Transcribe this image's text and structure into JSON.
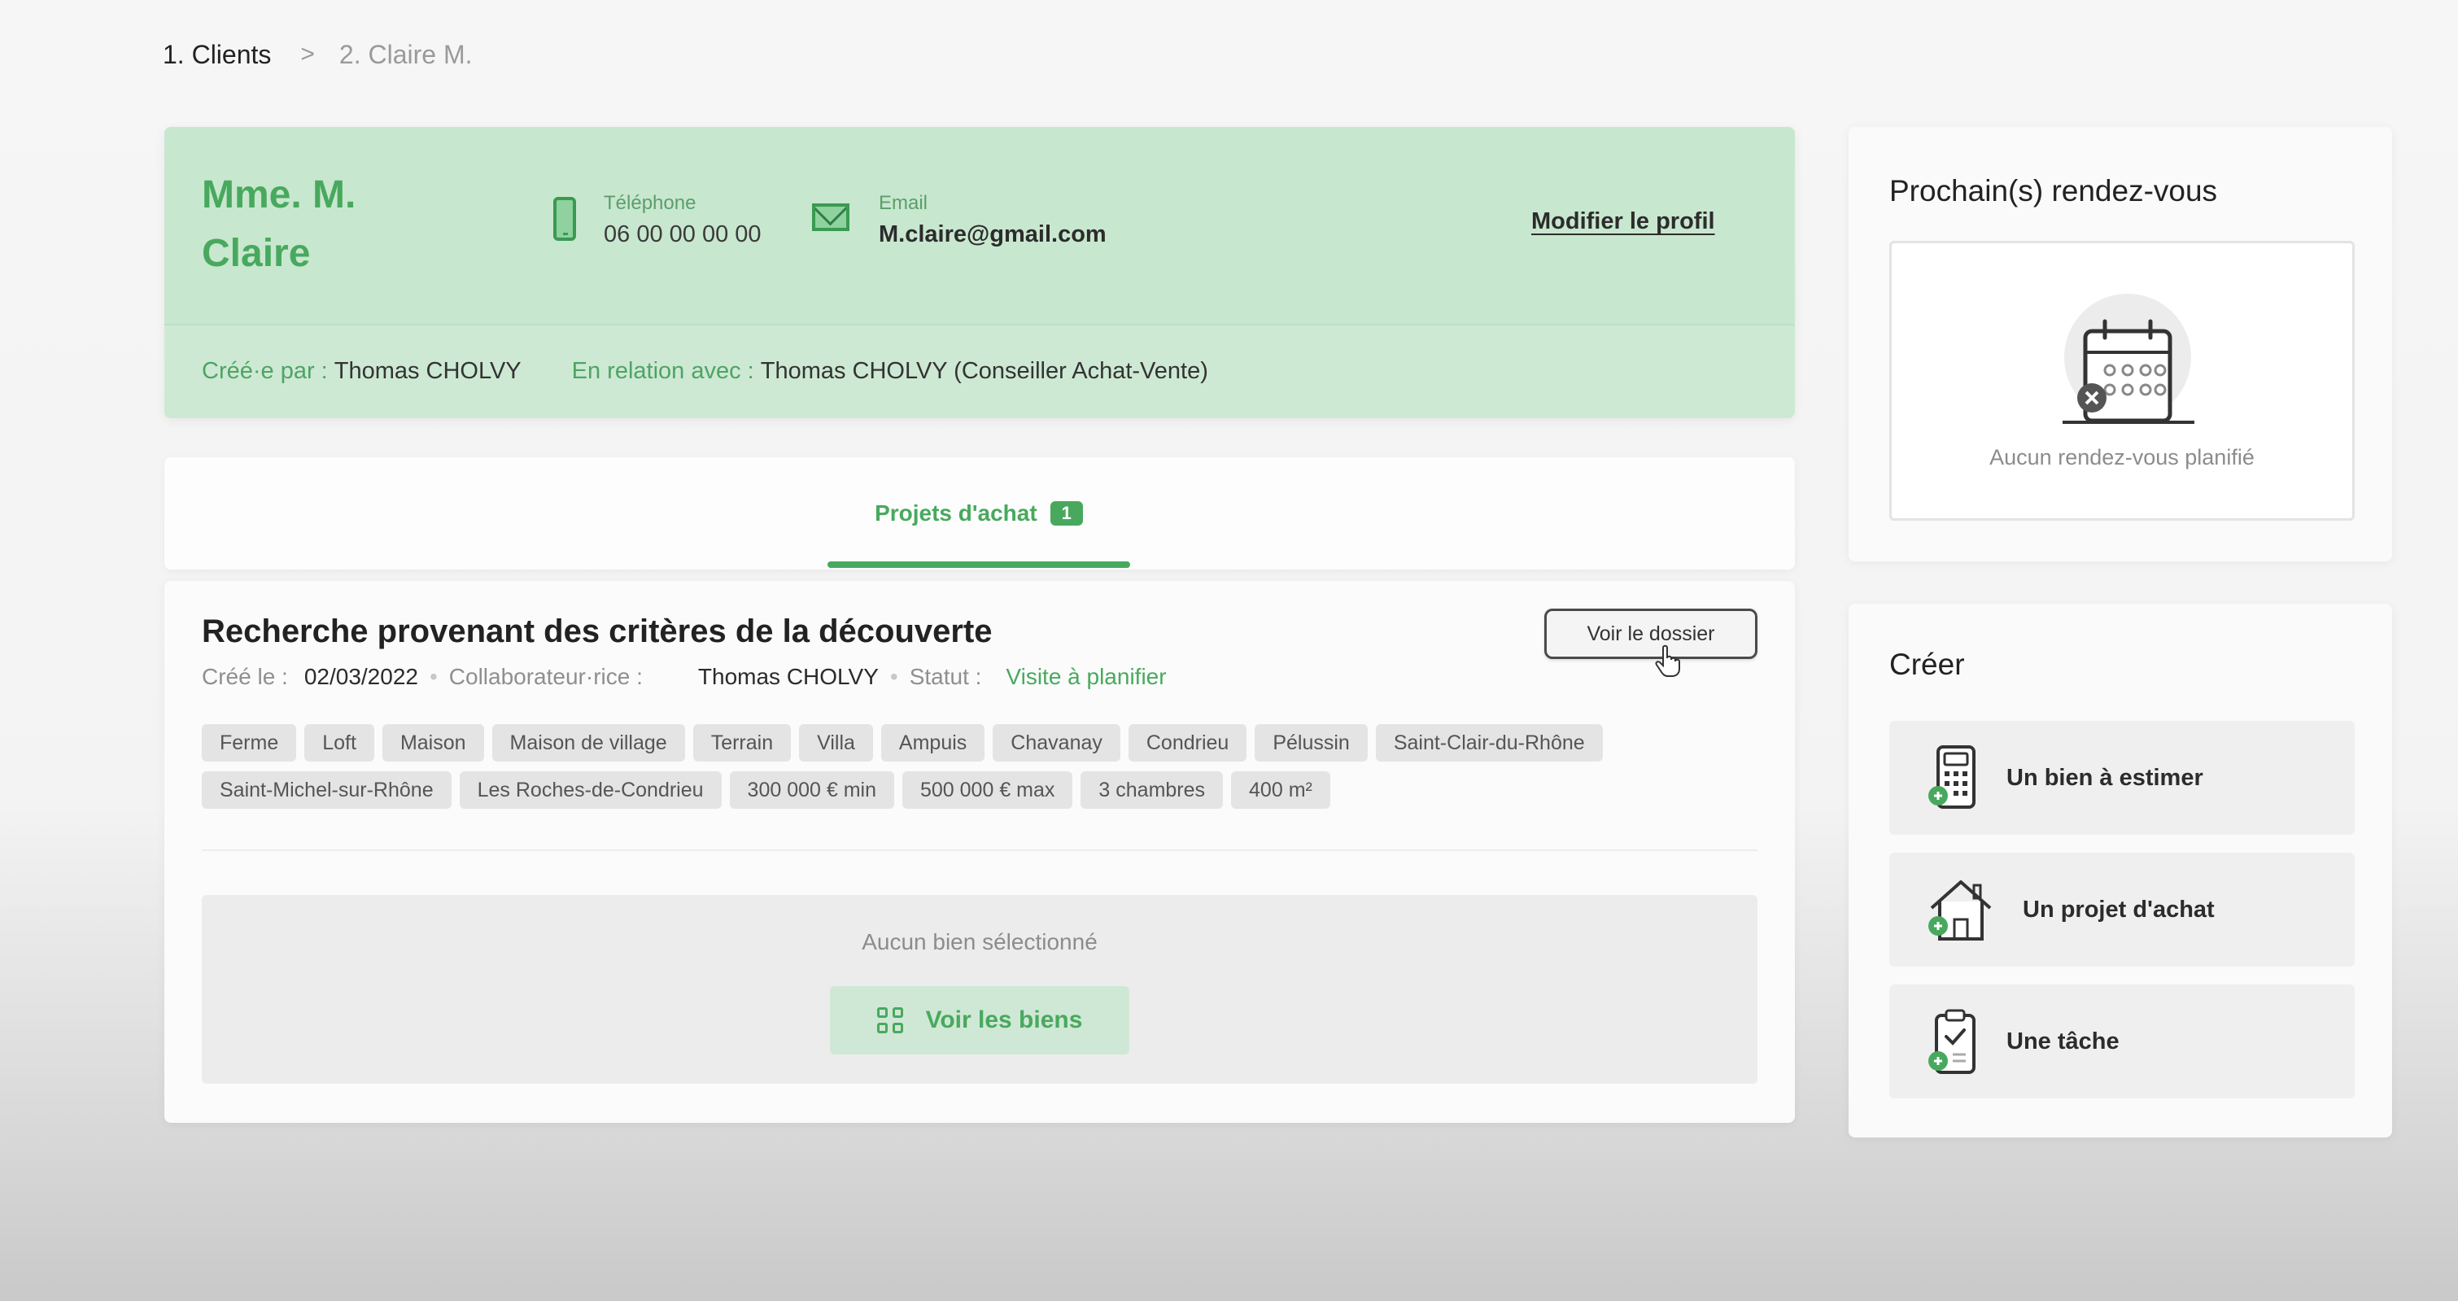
{
  "breadcrumb": {
    "step1": "1. Clients",
    "separator": ">",
    "step2": "2. Claire M."
  },
  "client": {
    "name": "Mme. M. Claire",
    "phone_label": "Téléphone",
    "phone_value": "06 00 00 00 00",
    "email_label": "Email",
    "email_value": "M.claire@gmail.com",
    "edit_profile": "Modifier le profil",
    "created_by_label": "Créé·e par :",
    "created_by_value": "Thomas CHOLVY",
    "relation_label": "En relation avec :",
    "relation_value": "Thomas CHOLVY (Conseiller Achat-Vente)"
  },
  "tabs": {
    "purchase_label": "Projets d'achat",
    "purchase_count": "1"
  },
  "project": {
    "title": "Recherche provenant des critères de la découverte",
    "created_label": "Créé le :",
    "created_value": "02/03/2022",
    "collaborator_label": "Collaborateur·rice :",
    "collaborator_value": "Thomas CHOLVY",
    "status_label": "Statut :",
    "status_value": "Visite à planifier",
    "open_file_button": "Voir le dossier",
    "tags": [
      "Ferme",
      "Loft",
      "Maison",
      "Maison de village",
      "Terrain",
      "Villa",
      "Ampuis",
      "Chavanay",
      "Condrieu",
      "Pélussin",
      "Saint-Clair-du-Rhône",
      "Saint-Michel-sur-Rhône",
      "Les Roches-de-Condrieu",
      "300 000 € min",
      "500 000 € max",
      "3 chambres",
      "400 m²"
    ],
    "empty_text": "Aucun bien sélectionné",
    "see_properties_button": "Voir les biens"
  },
  "appointments": {
    "title": "Prochain(s) rendez-vous",
    "empty_text": "Aucun rendez-vous planifié"
  },
  "create": {
    "title": "Créer",
    "items": [
      {
        "label": "Un bien à estimer",
        "icon": "calculator-icon"
      },
      {
        "label": "Un projet d'achat",
        "icon": "house-icon"
      },
      {
        "label": "Une tâche",
        "icon": "clipboard-icon"
      }
    ]
  },
  "colors": {
    "accent": "#48a95e",
    "profile_background": "#c8e7cf",
    "tag_background": "#e4e4e4"
  }
}
